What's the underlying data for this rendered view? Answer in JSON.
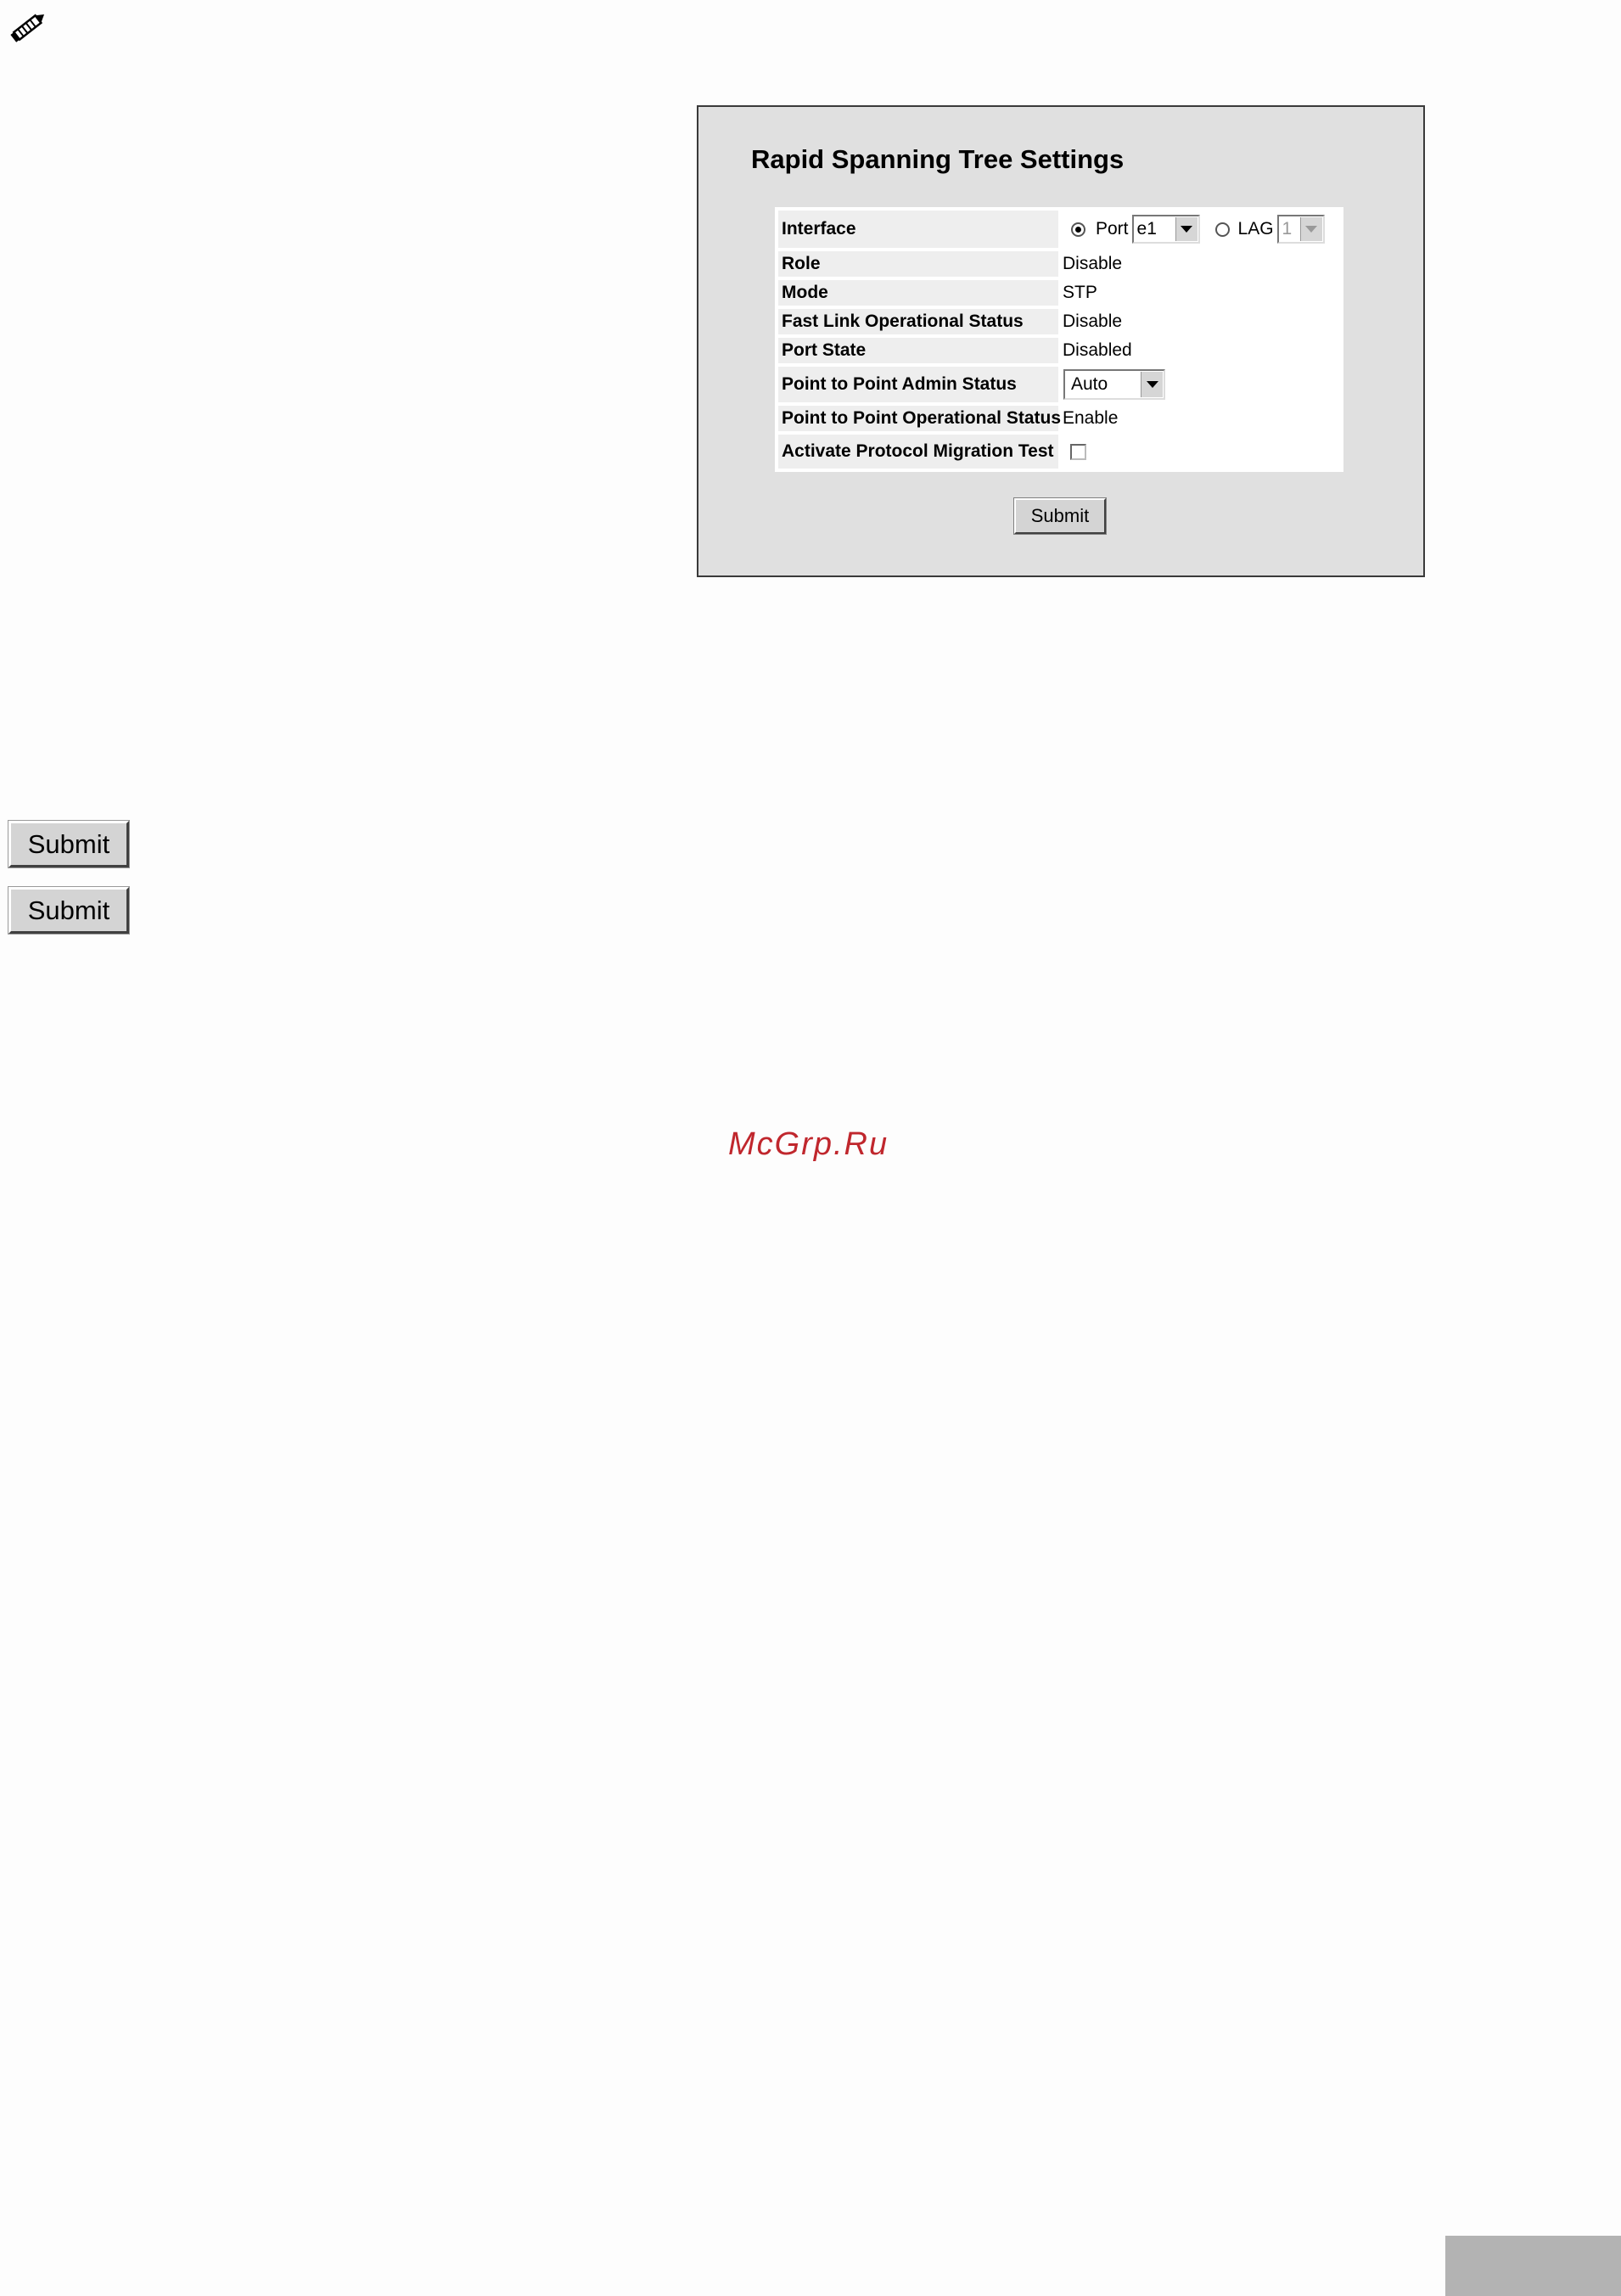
{
  "note_icon": "pencil-icon",
  "panel": {
    "title": "Rapid Spanning Tree Settings",
    "fields": {
      "interface": {
        "label": "Interface",
        "port_label": "Port",
        "port_value": "e1",
        "lag_label": "LAG",
        "lag_value": "1",
        "selected": "Port"
      },
      "role": {
        "label": "Role",
        "value": "Disable"
      },
      "mode": {
        "label": "Mode",
        "value": "STP"
      },
      "fast_link": {
        "label": "Fast Link Operational Status",
        "value": "Disable"
      },
      "port_state": {
        "label": "Port State",
        "value": "Disabled"
      },
      "p2p_admin": {
        "label": "Point to Point Admin Status",
        "value": "Auto"
      },
      "p2p_oper": {
        "label": "Point to Point Operational Status",
        "value": "Enable"
      },
      "migration": {
        "label": "Activate Protocol Migration Test",
        "checked": false
      }
    },
    "submit_label": "Submit"
  },
  "buttons": {
    "submit_1_label": "Submit",
    "submit_2_label": "Submit"
  },
  "watermark": "McGrp.Ru"
}
